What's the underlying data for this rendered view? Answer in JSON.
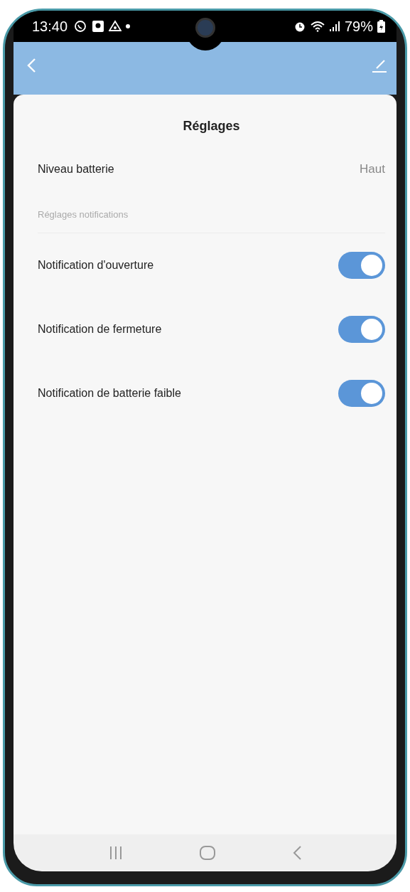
{
  "status_bar": {
    "time": "13:40",
    "battery": "79%"
  },
  "title": "Réglages",
  "battery_level": {
    "label": "Niveau batterie",
    "value": "Haut"
  },
  "section_header": "Réglages notifications",
  "toggles": [
    {
      "label": "Notification d'ouverture",
      "on": true
    },
    {
      "label": "Notification de fermeture",
      "on": true
    },
    {
      "label": "Notification de batterie faible",
      "on": true
    }
  ]
}
